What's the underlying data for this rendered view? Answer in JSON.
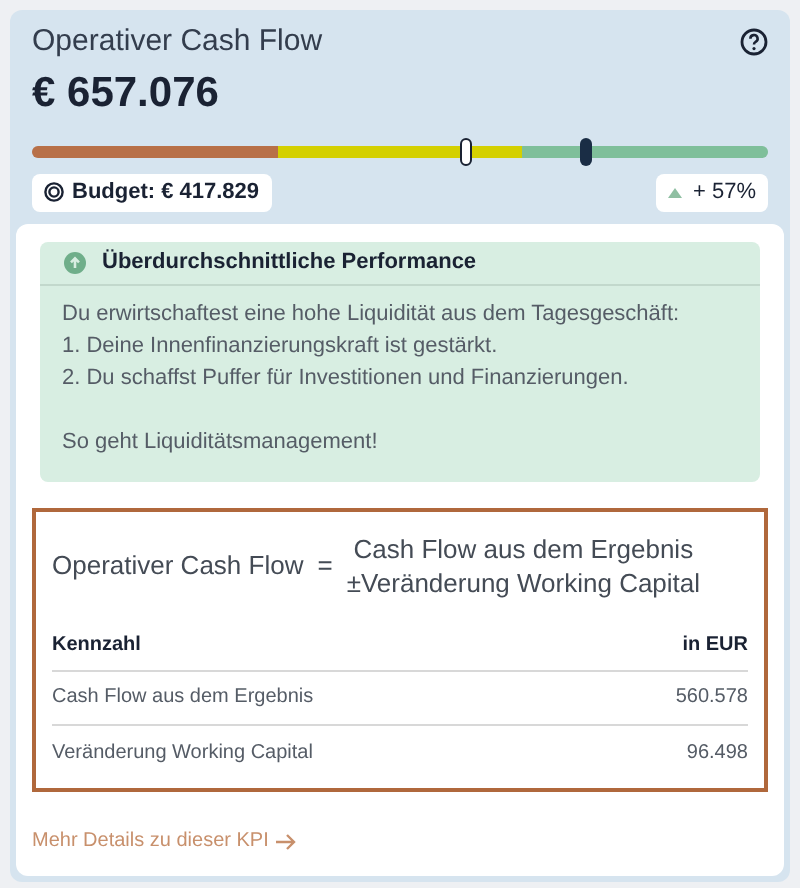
{
  "card": {
    "title": "Operativer Cash Flow",
    "value": "€ 657.076"
  },
  "gauge": {
    "segments": [
      {
        "color": "#b87048"
      },
      {
        "color": "#d4d000"
      },
      {
        "color": "#7fbf9a"
      }
    ],
    "markers": [
      {
        "kind": "budget",
        "level": 0.59
      },
      {
        "kind": "actual",
        "level": 0.753
      }
    ]
  },
  "budget": "Budget: € 417.829",
  "trend": {
    "text": "+ 57%"
  },
  "notice": {
    "title": "Überdurchschnittliche Performance",
    "lines": [
      "Du erwirtschaftest eine hohe Liquidität aus dem Tagesgeschäft:",
      "1. Deine Innenfinanzierungskraft ist gestärkt.",
      "2. Du schaffst Puffer für Investitionen und Finanzierungen."
    ],
    "closing": "So geht Liquiditätsmanagement!"
  },
  "formula": {
    "lhs": "Operativer Cash Flow",
    "operator": "=",
    "rhs": [
      "Cash Flow aus dem Ergebnis",
      "±Veränderung Working Capital"
    ]
  },
  "table": {
    "columns": [
      "Kennzahl",
      "in EUR"
    ],
    "rows": [
      [
        "Cash Flow aus dem Ergebnis",
        "560.578"
      ],
      [
        "Veränderung Working Capital",
        "96.498"
      ]
    ]
  },
  "link": "Mehr Details zu dieser KPI"
}
